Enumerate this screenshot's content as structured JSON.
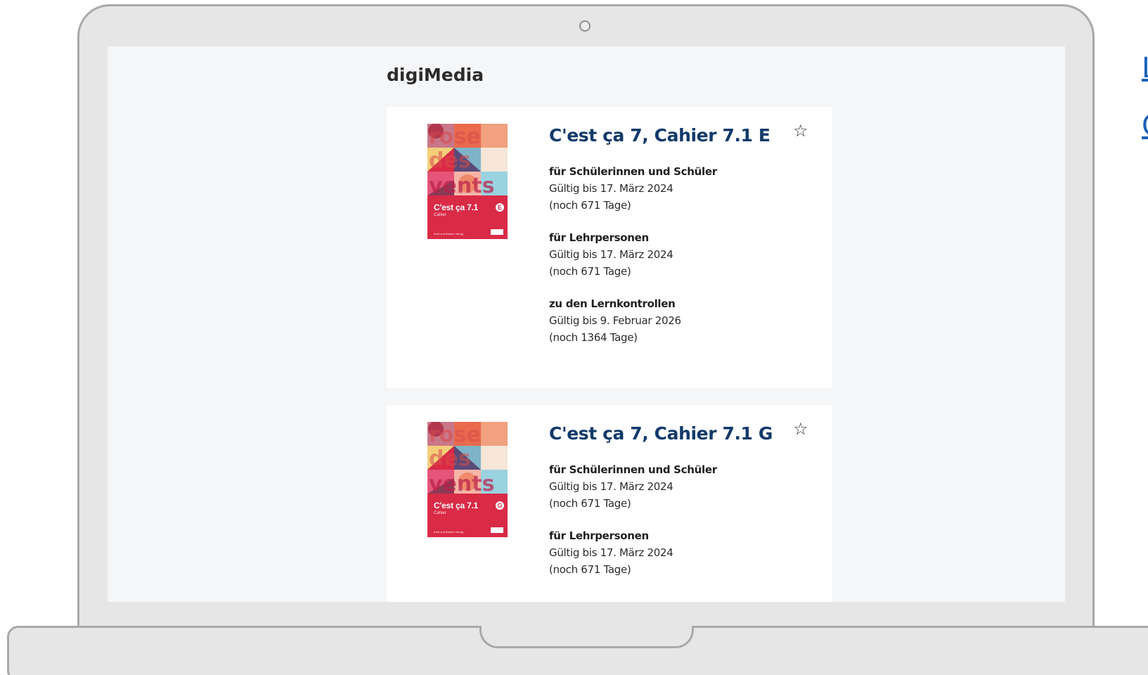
{
  "app": {
    "section_title": "digiMedia"
  },
  "outside_links": [
    "L",
    "G"
  ],
  "products": [
    {
      "title": "C'est ça 7, Cahier 7.1 E",
      "cover": {
        "title": "C'est ça 7.1",
        "subtitle": "Cahier",
        "badge": "E",
        "publisher": "Klett und Balmer Verlag"
      },
      "licenses": [
        {
          "label": "für Schülerinnen und Schüler",
          "valid": "Gültig bis 17. März 2024",
          "remaining": "(noch 671 Tage)"
        },
        {
          "label": "für Lehrpersonen",
          "valid": "Gültig bis 17. März 2024",
          "remaining": "(noch 671 Tage)"
        },
        {
          "label": "zu den Lernkontrollen",
          "valid": "Gültig bis 9. Februar 2026",
          "remaining": "(noch 1364 Tage)"
        }
      ]
    },
    {
      "title": "C'est ça 7, Cahier 7.1 G",
      "cover": {
        "title": "C'est ça 7.1",
        "subtitle": "Cahier",
        "badge": "G",
        "publisher": "Klett und Balmer Verlag"
      },
      "licenses": [
        {
          "label": "für Schülerinnen und Schüler",
          "valid": "Gültig bis 17. März 2024",
          "remaining": "(noch 671 Tage)"
        },
        {
          "label": "für Lehrpersonen",
          "valid": "Gültig bis 17. März 2024",
          "remaining": "(noch 671 Tage)"
        }
      ]
    }
  ],
  "colors": {
    "screen_bg": "#f5f6f8",
    "title_blue": "#123a6a",
    "cover_red": "#d92a46",
    "link_blue": "#1b62b8"
  },
  "icons": {
    "favorite": "star-outline-icon",
    "favorite_glyph": "☆"
  }
}
